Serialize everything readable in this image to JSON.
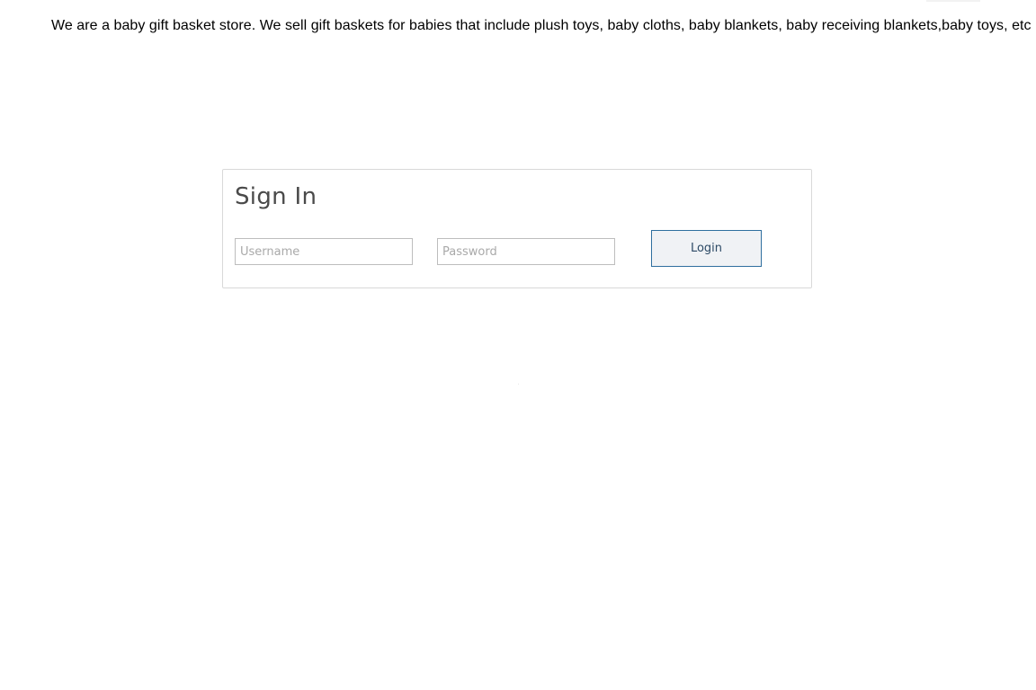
{
  "intro": {
    "text": "We are a baby gift basket store. We sell gift baskets for babies that include plush toys, baby cloths, baby blankets, baby receiving blankets,baby toys, etc"
  },
  "signin": {
    "title": "Sign In",
    "username_placeholder": "Username",
    "password_placeholder": "Password",
    "login_label": "Login"
  }
}
